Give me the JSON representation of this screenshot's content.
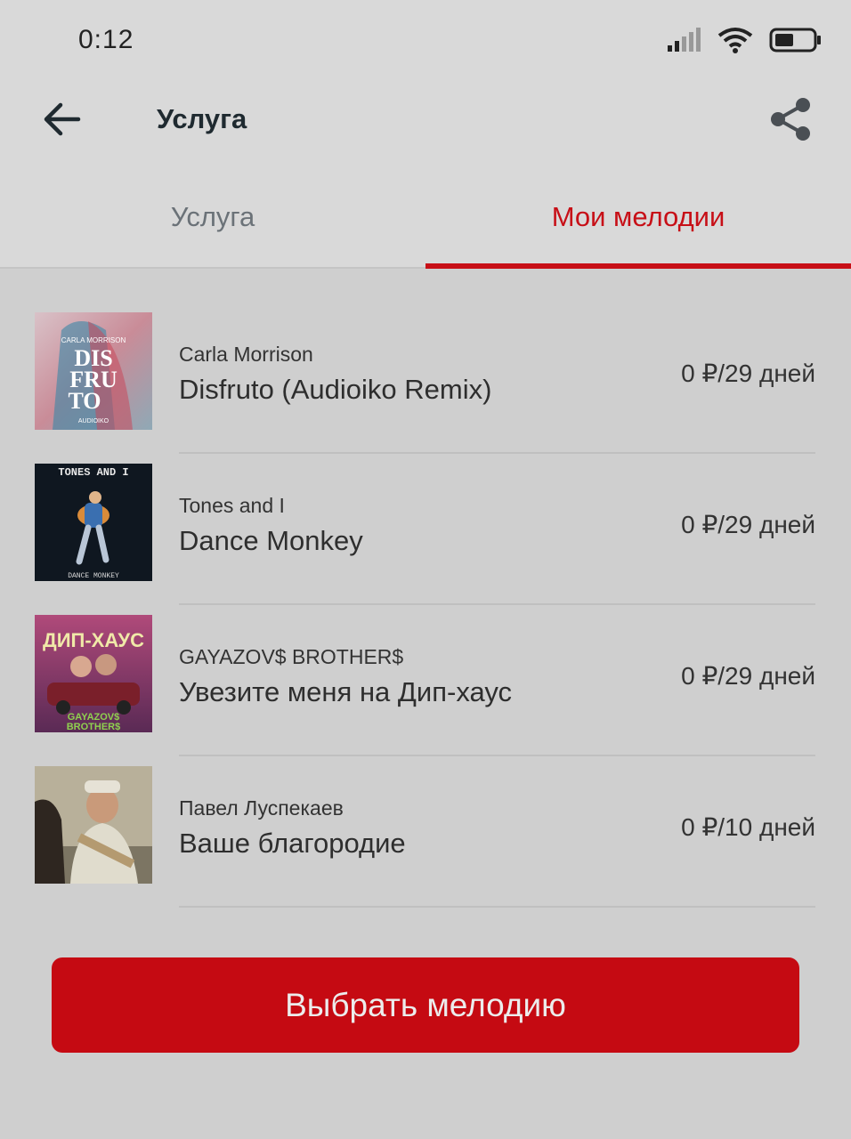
{
  "status_bar": {
    "time": "0:12"
  },
  "app_bar": {
    "title": "Услуга"
  },
  "tabs": [
    {
      "label": "Услуга",
      "active": false
    },
    {
      "label": "Мои мелодии",
      "active": true
    }
  ],
  "colors": {
    "accent": "#c70f17",
    "button": "#c50a12"
  },
  "melodies": [
    {
      "artist": "Carla Morrison",
      "title": "Disfruto (Audioiko Remix)",
      "price": "0 ₽/29 дней",
      "cover_text": [
        "CARLA MORRISON",
        "DIS",
        "FRU",
        "TO",
        "AUDIOIKO"
      ]
    },
    {
      "artist": "Tones and I",
      "title": "Dance Monkey",
      "price": "0 ₽/29 дней",
      "cover_text": [
        "TONES AND I",
        "DANCE MONKEY"
      ]
    },
    {
      "artist": "GAYAZOV$ BROTHER$",
      "title": "Увезите меня на Дип-хаус",
      "price": "0 ₽/29 дней",
      "cover_text": [
        "ДИП-ХАУС",
        "GAYAZOV$",
        "BROTHER$"
      ]
    },
    {
      "artist": "Павел Луспекаев",
      "title": "Ваше благородие",
      "price": "0 ₽/10 дней",
      "cover_text": []
    }
  ],
  "cta": {
    "label": "Выбрать мелодию"
  }
}
